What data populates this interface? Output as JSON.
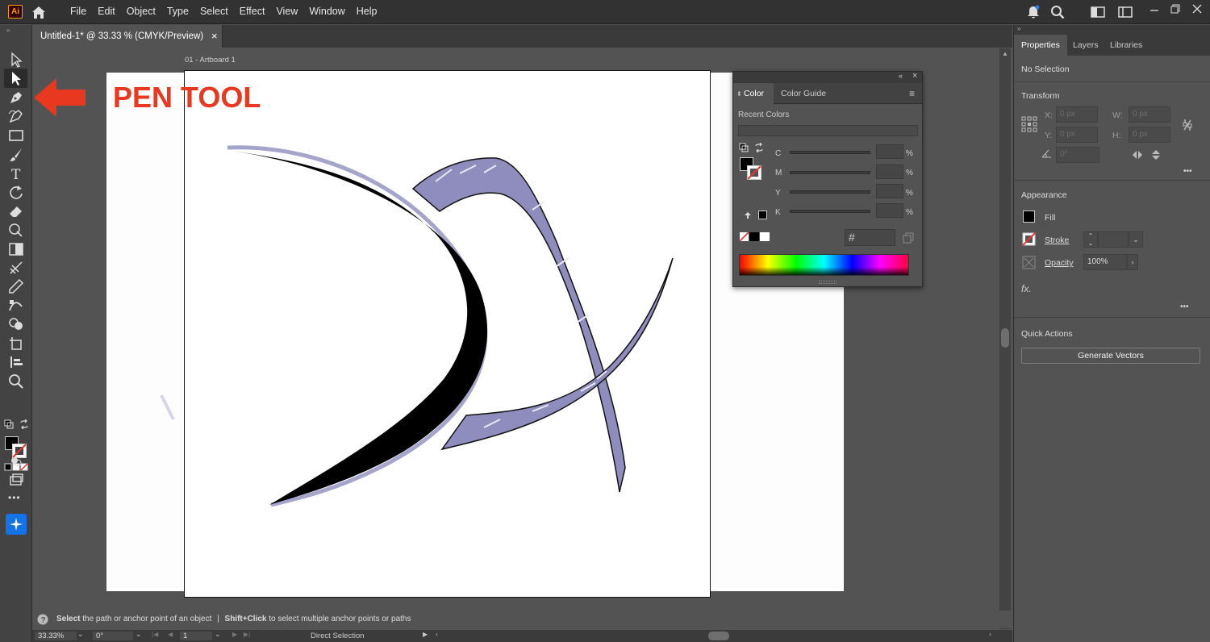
{
  "app": {
    "logo": "Ai"
  },
  "menu": [
    "File",
    "Edit",
    "Object",
    "Type",
    "Select",
    "Effect",
    "View",
    "Window",
    "Help"
  ],
  "document": {
    "tab_title": "Untitled-1* @ 33.33 % (CMYK/Preview)",
    "close": "×",
    "artboard_label": "01 - Artboard 1"
  },
  "annotation": {
    "label": "PEN TOOL",
    "color": "#e8381f"
  },
  "color_panel": {
    "tabs": [
      "Color",
      "Color Guide"
    ],
    "recent_colors_label": "Recent Colors",
    "channels": [
      "C",
      "M",
      "Y",
      "K"
    ],
    "percent": "%",
    "hex_symbol": "#"
  },
  "properties": {
    "tabs": [
      "Properties",
      "Layers",
      "Libraries"
    ],
    "selection": "No Selection",
    "transform": {
      "title": "Transform",
      "x_label": "X:",
      "x_value": "0 px",
      "y_label": "Y:",
      "y_value": "0 px",
      "w_label": "W:",
      "w_value": "0 px",
      "h_label": "H:",
      "h_value": "0 px",
      "angle_value": "0°"
    },
    "appearance": {
      "title": "Appearance",
      "fill": "Fill",
      "stroke": "Stroke",
      "opacity": "Opacity",
      "opacity_value": "100%",
      "fx": "fx."
    },
    "quick_actions": {
      "title": "Quick Actions",
      "button": "Generate Vectors"
    },
    "more": "•••"
  },
  "status": {
    "part1_bold": "Select",
    "part1": " the path or anchor point of an object",
    "sep": "|",
    "part2_bold": "Shift+Click",
    "part2": " to select multiple anchor points or paths"
  },
  "bottom": {
    "zoom": "33.33%",
    "rotation": "0°",
    "artboard_num": "1",
    "tool": "Direct Selection"
  },
  "colors": {
    "accent": "#1473e6",
    "stroke_purple": "#8f8dbd",
    "arrow_red": "#e8381f"
  }
}
